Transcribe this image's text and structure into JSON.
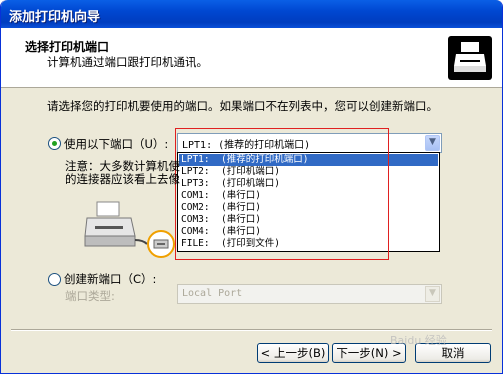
{
  "window": {
    "title": "添加打印机向导"
  },
  "header": {
    "title": "选择打印机端口",
    "subtitle": "计算机通过端口跟打印机通讯。"
  },
  "prompt": "请选择您的打印机要使用的端口。如果端口不在列表中，您可以创建新端口。",
  "use_port": {
    "label": "使用以下端口（U）:",
    "selected": true,
    "value": "LPT1:  (推荐的打印机端口)"
  },
  "dropdown": {
    "items": [
      "LPT1:  (推荐的打印机端口)",
      "LPT2:  (打印机端口)",
      "LPT3:  (打印机端口)",
      "COM1:  (串行口)",
      "COM2:  (串行口)",
      "COM3:  (串行口)",
      "COM4:  (串行口)",
      "FILE:  (打印到文件)"
    ],
    "highlighted_index": 0
  },
  "note": {
    "line1": "注意：大多数计算机使",
    "line2": "的连接器应该看上去像"
  },
  "create_port": {
    "label": "创建新端口（C）:",
    "selected": false,
    "type_label": "端口类型:",
    "type_value": "Local Port"
  },
  "buttons": {
    "back": "< 上一步(B)",
    "next": "下一步(N) >",
    "cancel": "取消"
  },
  "watermark": "Baidu 经验"
}
